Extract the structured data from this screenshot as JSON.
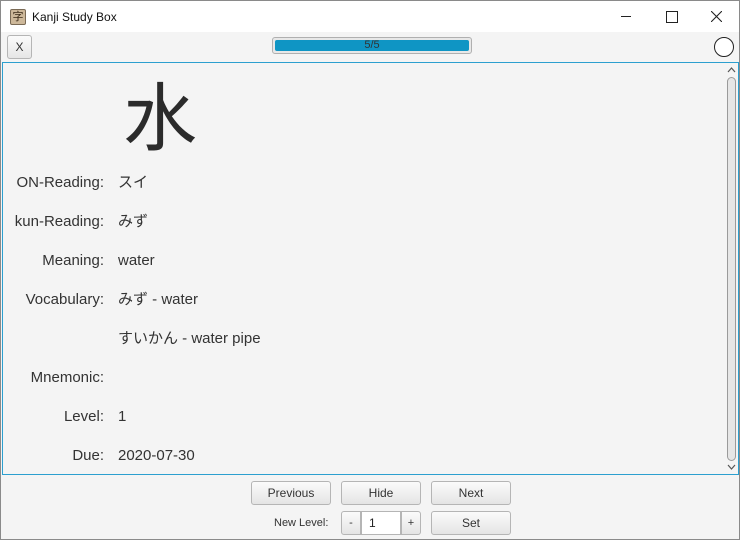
{
  "window": {
    "title": "Kanji Study Box",
    "app_icon_glyph": "字"
  },
  "toolbar": {
    "close_label": "X",
    "progress_text": "5/5",
    "progress_value": 1.0,
    "accent_color": "#0f95c4"
  },
  "card": {
    "kanji": "水",
    "rows": [
      {
        "label": "ON-Reading:",
        "value": "スイ"
      },
      {
        "label": "kun-Reading:",
        "value": "みず"
      },
      {
        "label": "Meaning:",
        "value": "water"
      },
      {
        "label": "Vocabulary:",
        "value": "みず - water"
      },
      {
        "label": "",
        "value": "すいかん - water pipe"
      },
      {
        "label": "Mnemonic:",
        "value": ""
      },
      {
        "label": "Level:",
        "value": "1"
      },
      {
        "label": "Due:",
        "value": "2020-07-30"
      }
    ]
  },
  "controls": {
    "previous_label": "Previous",
    "hide_label": "Hide",
    "next_label": "Next",
    "new_level_label": "New Level:",
    "decrement_label": "-",
    "increment_label": "+",
    "level_value": "1",
    "set_label": "Set"
  },
  "icons": {
    "app": "kanji-app-icon",
    "minimize": "minimize-icon",
    "maximize": "maximize-icon",
    "close": "close-icon",
    "status": "circle-status-icon"
  }
}
